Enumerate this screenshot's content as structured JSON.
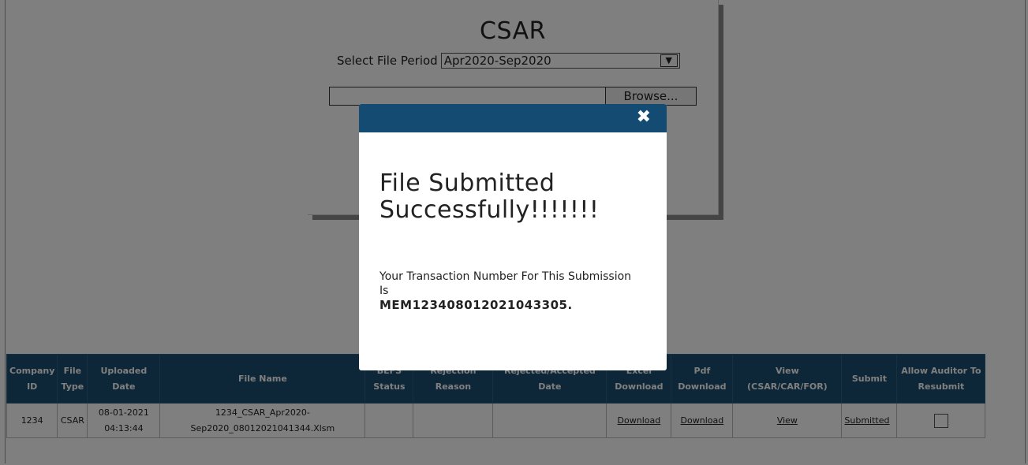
{
  "panel": {
    "title": "CSAR",
    "period_label": "Select File Period",
    "period_value": "Apr2020-Sep2020",
    "browse_label": "Browse..."
  },
  "table": {
    "headers": [
      "Company ID",
      "File Type",
      "Uploaded Date",
      "File Name",
      "BEFS Status",
      "Rejection Reason",
      "Rejected/Accepted Date",
      "Excel Download",
      "Pdf Download",
      "View (CSAR/CAR/FOR)",
      "Submit",
      "Allow Auditor To Resubmit"
    ],
    "row": {
      "company_id": "1234",
      "file_type": "CSAR",
      "uploaded_date": "08-01-2021",
      "uploaded_time": "04:13:44",
      "file_name_line1": "1234_CSAR_Apr2020-",
      "file_name_line2": "Sep2020_08012021041344.Xlsm",
      "befs_status": "",
      "rejection_reason": "",
      "rejected_accepted_date": "",
      "excel_download": "Download",
      "pdf_download": "Download",
      "view": "View",
      "submit": "Submitted",
      "allow_resubmit_checked": false
    }
  },
  "modal": {
    "close_icon": "close-icon",
    "heading": "File Submitted Successfully!!!!!!!",
    "message": "Your Transaction Number For This Submission Is",
    "transaction_number": "MEM123408012021043305."
  },
  "colors": {
    "header_bg": "#1d4f70",
    "modal_header_bg": "#134b73"
  }
}
